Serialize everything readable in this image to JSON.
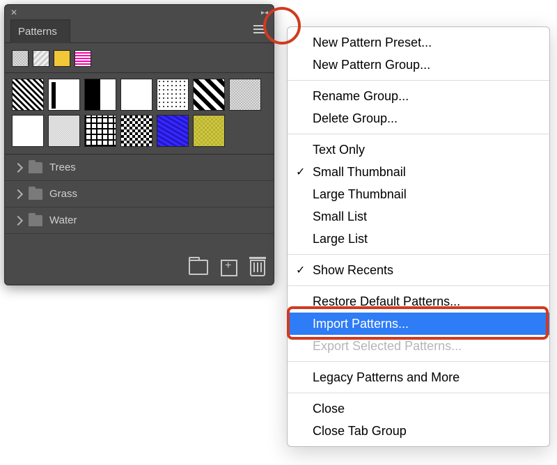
{
  "panel": {
    "title": "Patterns",
    "folders": [
      "Trees",
      "Grass",
      "Water"
    ]
  },
  "menu": {
    "items": [
      {
        "label": "New Pattern Preset...",
        "checked": false,
        "disabled": false
      },
      {
        "label": "New Pattern Group...",
        "checked": false,
        "disabled": false
      },
      {
        "sep": true
      },
      {
        "label": "Rename Group...",
        "checked": false,
        "disabled": false
      },
      {
        "label": "Delete Group...",
        "checked": false,
        "disabled": false
      },
      {
        "sep": true
      },
      {
        "label": "Text Only",
        "checked": false,
        "disabled": false
      },
      {
        "label": "Small Thumbnail",
        "checked": true,
        "disabled": false
      },
      {
        "label": "Large Thumbnail",
        "checked": false,
        "disabled": false
      },
      {
        "label": "Small List",
        "checked": false,
        "disabled": false
      },
      {
        "label": "Large List",
        "checked": false,
        "disabled": false
      },
      {
        "sep": true
      },
      {
        "label": "Show Recents",
        "checked": true,
        "disabled": false
      },
      {
        "sep": true
      },
      {
        "label": "Restore Default Patterns...",
        "checked": false,
        "disabled": false
      },
      {
        "label": "Import Patterns...",
        "checked": false,
        "disabled": false,
        "selected": true
      },
      {
        "label": "Export Selected Patterns...",
        "checked": false,
        "disabled": true
      },
      {
        "sep": true
      },
      {
        "label": "Legacy Patterns and More",
        "checked": false,
        "disabled": false
      },
      {
        "sep": true
      },
      {
        "label": "Close",
        "checked": false,
        "disabled": false
      },
      {
        "label": "Close Tab Group",
        "checked": false,
        "disabled": false
      }
    ]
  }
}
